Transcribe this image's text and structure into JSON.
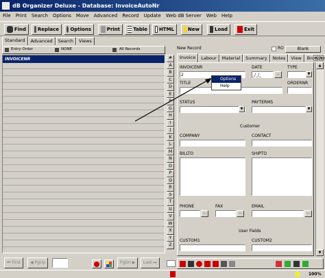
{
  "window": {
    "title": "dB Organizer Deluxe - Database: InvoiceAutoNr"
  },
  "menu": [
    "File",
    "Print",
    "Search",
    "Options",
    "Move",
    "Advanced",
    "Record",
    "Update",
    "Web dB Server",
    "Web",
    "Help"
  ],
  "toolbar": {
    "find": "Find",
    "replace": "Replace",
    "options": "Options",
    "print": "Print",
    "table": "Table",
    "html": "HTML",
    "new": "New",
    "load": "Load",
    "exit": "Exit"
  },
  "left_tabs": [
    "Standard",
    "Advanced",
    "Search",
    "Views"
  ],
  "left_header": {
    "sort": "Entry Order",
    "filter": "NONE",
    "records": "All Records"
  },
  "list": {
    "column": "INVOICENR"
  },
  "letters": [
    "#",
    "A",
    "B",
    "C",
    "D",
    "E",
    "F",
    "G",
    "H",
    "I",
    "J",
    "K",
    "L",
    "M",
    "N",
    "O",
    "P",
    "Q",
    "R",
    "S",
    "T",
    "U",
    "V",
    "W",
    "X",
    "Y",
    "Z"
  ],
  "record": {
    "title": "New Record",
    "ro_label": "RO",
    "blank_button": "Blank"
  },
  "record_tabs": [
    "Invoice",
    "Labour",
    "Material",
    "Summary",
    "Notes",
    "View",
    "Browser"
  ],
  "fields": {
    "invoicenr": "INVOICENR",
    "invoicenr_value": "2",
    "date": "DATE",
    "date_value": "_/_/_",
    "type": "TYPE",
    "title": "TITLE",
    "ordernr": "ORDERNR",
    "status": "STATUS",
    "payterms": "PAYTERMS",
    "customer_section": "Customer",
    "company": "COMPANY",
    "contact": "CONTACT",
    "billto": "BILLTO",
    "shipto": "SHIPTO",
    "phone": "PHONE",
    "fax": "FAX",
    "email": "EMAIL",
    "user_section": "User Fields",
    "custom1": "CUSTOM1",
    "custom2": "CUSTOM2"
  },
  "bottom": {
    "first": "First",
    "pgup": "PgUp",
    "pgdn": "PgDn",
    "last": "Last"
  },
  "popup": {
    "items": [
      "Options",
      "Help"
    ]
  },
  "status": {
    "zoom": "100%"
  },
  "colors": {
    "title_bg": "#0a246a",
    "list_header": "#0a246a",
    "face": "#d4d0c8"
  }
}
